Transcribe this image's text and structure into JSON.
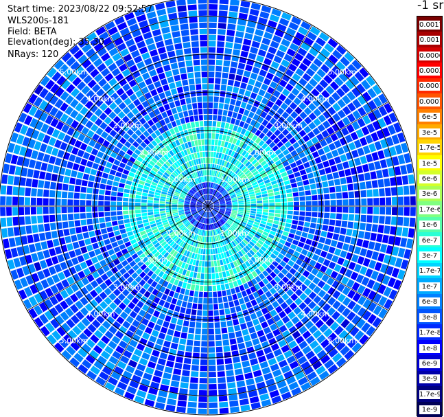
{
  "info": {
    "start_time": "Start time: 2023/08/22 09:52:57",
    "instrument": "WLS200s-181",
    "field": "Field: BETA",
    "elevation": "Elevation(deg): 35.30",
    "nrays": "NRays: 120"
  },
  "colorbar": {
    "unit": "-1 sr",
    "entries": [
      {
        "label": "0.0017",
        "color": "#7a0000"
      },
      {
        "label": "0.001",
        "color": "#a80000"
      },
      {
        "label": "0.0006",
        "color": "#d40000"
      },
      {
        "label": "0.0003",
        "color": "#ff0000"
      },
      {
        "label": "0.00017",
        "color": "#ff2a00"
      },
      {
        "label": "0.0001",
        "color": "#ff5500"
      },
      {
        "label": "6e-5",
        "color": "#ff8000"
      },
      {
        "label": "3e-5",
        "color": "#ffaa00"
      },
      {
        "label": "1.7e-5",
        "color": "#ffd400"
      },
      {
        "label": "1e-5",
        "color": "#ffff00"
      },
      {
        "label": "6e-6",
        "color": "#d4ff2a"
      },
      {
        "label": "3e-6",
        "color": "#aaff55"
      },
      {
        "label": "1.7e-6",
        "color": "#80ff80"
      },
      {
        "label": "1e-6",
        "color": "#55ffaa"
      },
      {
        "label": "6e-7",
        "color": "#2affd4"
      },
      {
        "label": "3e-7",
        "color": "#00ffff"
      },
      {
        "label": "1.7e-7",
        "color": "#00d4ff"
      },
      {
        "label": "1e-7",
        "color": "#00aaff"
      },
      {
        "label": "6e-8",
        "color": "#0080ff"
      },
      {
        "label": "3e-8",
        "color": "#0055ff"
      },
      {
        "label": "1.7e-8",
        "color": "#002aff"
      },
      {
        "label": "1e-8",
        "color": "#0000ff"
      },
      {
        "label": "6e-9",
        "color": "#0000d4"
      },
      {
        "label": "3e-9",
        "color": "#0000aa"
      },
      {
        "label": "1.7e-9",
        "color": "#000080"
      },
      {
        "label": "1e-9",
        "color": "#000055"
      }
    ]
  },
  "chart_data": {
    "type": "heatmap",
    "projection": "polar PPI scan",
    "field": "BETA",
    "elevation_deg": 35.3,
    "n_rays": 120,
    "max_range_km": 5.5,
    "range_rings_km": [
      1,
      2,
      3,
      4,
      5
    ],
    "range_labels": [
      "1.00km",
      "2.00km",
      "3.00km",
      "4.00km",
      "5.00km"
    ],
    "spoke_azimuths_deg": [
      0,
      30,
      60,
      90,
      120,
      150,
      180,
      210,
      240,
      270,
      300,
      330
    ],
    "label_azimuths_deg": [
      45,
      135,
      225,
      315
    ],
    "value_scale": "log",
    "value_range": [
      1e-09,
      0.0017
    ],
    "typical_values": [
      {
        "range_km": [
          0,
          0.6
        ],
        "beta": 1.7e-08
      },
      {
        "range_km": [
          0.6,
          2.2
        ],
        "beta": 3e-07
      },
      {
        "range_km": [
          2.2,
          5.5
        ],
        "beta": 3e-08
      }
    ],
    "legend_placement": "right"
  }
}
